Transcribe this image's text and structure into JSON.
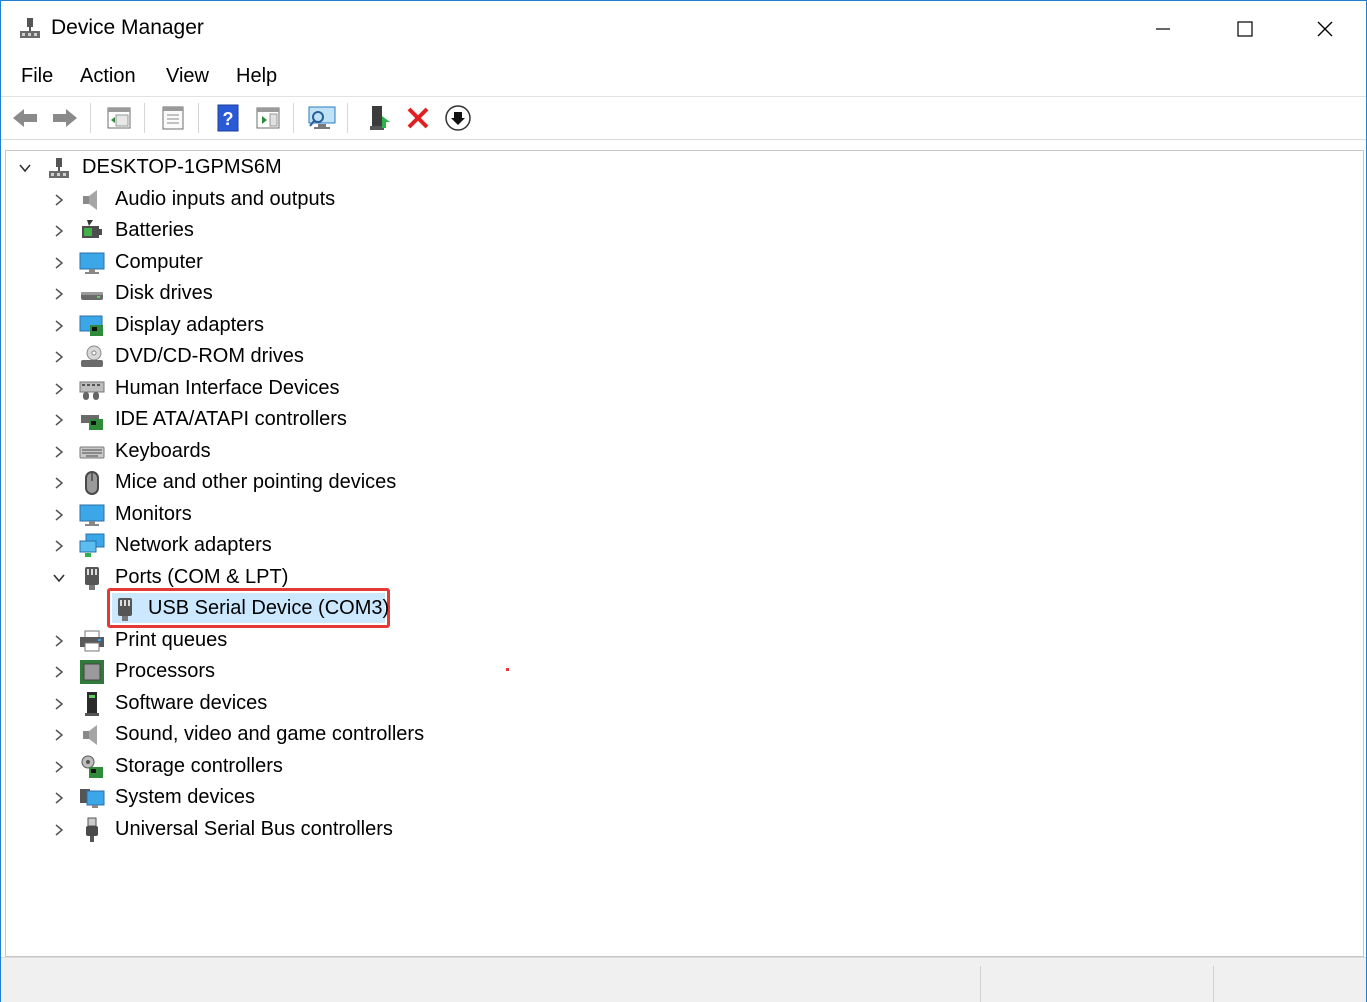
{
  "window": {
    "title": "Device Manager",
    "accent_color": "#1e7fd4",
    "controls": {
      "minimize": "minimize-icon",
      "maximize": "maximize-icon",
      "close": "close-icon"
    }
  },
  "menu": [
    "File",
    "Action",
    "View",
    "Help"
  ],
  "toolbar": [
    "back-arrow-icon",
    "forward-arrow-icon",
    "show-hide-console-tree-icon",
    "properties-icon",
    "help-icon",
    "action-pane-icon",
    "scan-hardware-changes-icon",
    "update-driver-icon",
    "uninstall-device-icon",
    "disable-device-icon"
  ],
  "tree": {
    "root": "DESKTOP-1GPMS6M",
    "categories": [
      "Audio inputs and outputs",
      "Batteries",
      "Computer",
      "Disk drives",
      "Display adapters",
      "DVD/CD-ROM drives",
      "Human Interface Devices",
      "IDE ATA/ATAPI controllers",
      "Keyboards",
      "Mice and other pointing devices",
      "Monitors",
      "Network adapters",
      "Ports (COM & LPT)",
      "Print queues",
      "Processors",
      "Software devices",
      "Sound, video and game controllers",
      "Storage controllers",
      "System devices",
      "Universal Serial Bus controllers"
    ],
    "expanded_category": "Ports (COM & LPT)",
    "child_device": "USB Serial Device (COM3)",
    "highlight_color": "#e53935",
    "selection_color": "#cce8ff"
  }
}
